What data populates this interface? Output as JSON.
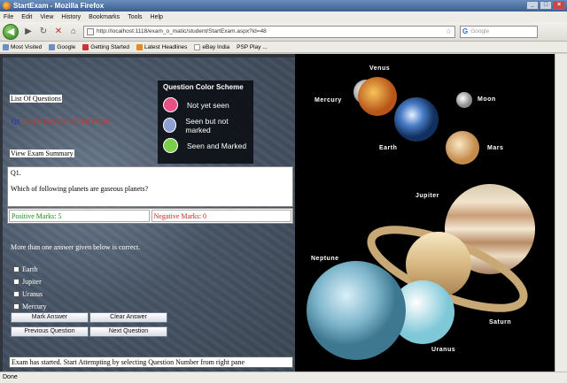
{
  "window": {
    "title": "StartExam - Mozilla Firefox"
  },
  "menu": [
    "File",
    "Edit",
    "View",
    "History",
    "Bookmarks",
    "Tools",
    "Help"
  ],
  "nav": {
    "url": "http://localhost:1118/exam_o_matic/student/StartExam.aspx?id=48",
    "search_placeholder": "Google"
  },
  "bookmarks": [
    "Most Visited",
    "Google",
    "Getting Started",
    "Latest Headlines",
    "eBay India",
    "PSP Play ..."
  ],
  "exam": {
    "list_heading": "List Of Questions",
    "question_links": [
      "Q1",
      "Q2",
      "Q3",
      "Q4",
      "Q5",
      "Q6",
      "Q7",
      "Q8",
      "Q9",
      "Q10"
    ],
    "view_summary": "View Exam Summary",
    "question_number": "Q1.",
    "question_text": "Which of following planets are gaseous planets?",
    "positive_marks": "Positive Marks: 5",
    "negative_marks": "Negative Marks: 0",
    "note": "More than one answer given below is correct.",
    "options": [
      "Earth",
      "Jupiter",
      "Uranus",
      "Mercury"
    ],
    "buttons": {
      "mark": "Mark Answer",
      "clear": "Clear Answer",
      "previous": "Previous Question",
      "next": "Next Question"
    },
    "status_message": "Exam has started. Start Attempting by selecting Question Number from right pane"
  },
  "legend": {
    "title": "Question Color Scheme",
    "items": [
      {
        "label": "Not yet seen",
        "color": "#ea4f86"
      },
      {
        "label": "Seen but not marked",
        "color": "#8e9fd2"
      },
      {
        "label": "Seen and Marked",
        "color": "#7ccf4a"
      }
    ]
  },
  "planets": {
    "venus": "Venus",
    "mercury": "Mercury",
    "moon": "Moon",
    "earth": "Earth",
    "mars": "Mars",
    "jupiter": "Jupiter",
    "neptune": "Neptune",
    "saturn": "Saturn",
    "uranus": "Uranus"
  },
  "statusbar": {
    "text": "Done"
  }
}
